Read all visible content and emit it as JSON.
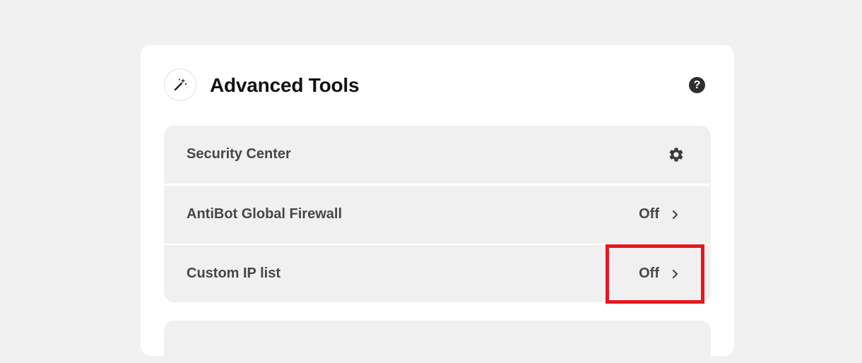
{
  "panel": {
    "title": "Advanced Tools",
    "title_icon": "magic-wand-icon",
    "help_icon": "help-icon",
    "help_glyph": "?"
  },
  "settings": {
    "items": [
      {
        "label": "Security Center",
        "icon": "gear-icon"
      },
      {
        "label": "AntiBot Global Firewall",
        "value": "Off",
        "icon": "chevron-right-icon"
      },
      {
        "label": "Custom IP list",
        "value": "Off",
        "icon": "chevron-right-icon"
      }
    ]
  },
  "annotation": {
    "highlight_color": "#e3191f",
    "highlighted_item": "Custom IP list status"
  },
  "colors": {
    "background": "#f1f1f1",
    "card": "#ffffff",
    "row": "#f0f0f0",
    "text": "#474747",
    "title": "#111111"
  }
}
